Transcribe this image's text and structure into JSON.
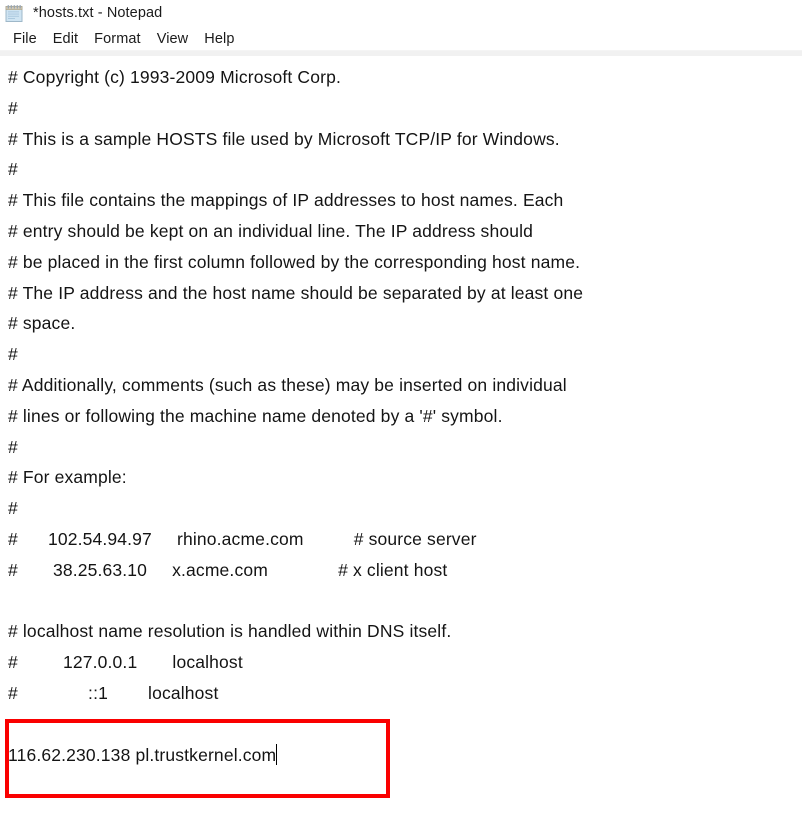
{
  "window": {
    "title": "*hosts.txt - Notepad",
    "icon": "notepad-icon"
  },
  "menubar": {
    "items": [
      {
        "label": "File"
      },
      {
        "label": "Edit"
      },
      {
        "label": "Format"
      },
      {
        "label": "View"
      },
      {
        "label": "Help"
      }
    ]
  },
  "document": {
    "filename": "hosts.txt",
    "modified": true,
    "lines": [
      "# Copyright (c) 1993-2009 Microsoft Corp.",
      "#",
      "# This is a sample HOSTS file used by Microsoft TCP/IP for Windows.",
      "#",
      "# This file contains the mappings of IP addresses to host names. Each",
      "# entry should be kept on an individual line. The IP address should",
      "# be placed in the first column followed by the corresponding host name.",
      "# The IP address and the host name should be separated by at least one",
      "# space.",
      "#",
      "# Additionally, comments (such as these) may be inserted on individual",
      "# lines or following the machine name denoted by a '#' symbol.",
      "#",
      "# For example:",
      "#",
      "#      102.54.94.97     rhino.acme.com          # source server",
      "#       38.25.63.10     x.acme.com              # x client host",
      "",
      "# localhost name resolution is handled within DNS itself.",
      "#         127.0.0.1       localhost",
      "#              ::1        localhost",
      "",
      "116.62.230.138 pl.trustkernel.com"
    ],
    "caret_line_index": 22,
    "caret_visible": true
  },
  "annotation": {
    "type": "rectangle-highlight",
    "color": "#fa0000",
    "target_text": "116.62.230.138 pl.trustkernel.com"
  },
  "colors": {
    "background": "#ffffff",
    "text": "#141414",
    "chrome_text": "#1b1b1b",
    "separator": "#f1f1f1",
    "annotation_red": "#fa0000"
  }
}
